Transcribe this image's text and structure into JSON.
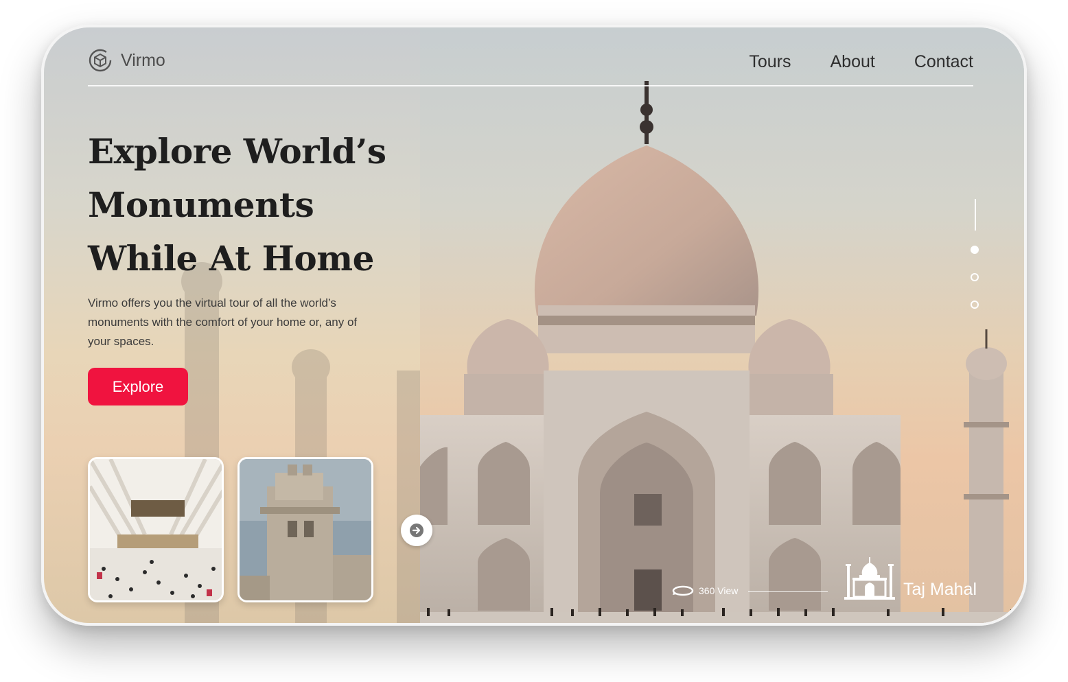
{
  "brand": {
    "name": "Virmo"
  },
  "nav": {
    "items": [
      "Tours",
      "About",
      "Contact"
    ]
  },
  "hero": {
    "headline": [
      "Explore World’s",
      "Monuments",
      "While At Home"
    ],
    "description": "Virmo offers you the virtual tour of all the world’s monuments with the comfort of your home or, any of your spaces.",
    "cta_label": "Explore"
  },
  "slider": {
    "active_index": 0,
    "count": 3
  },
  "viewer": {
    "view_label": "360 View",
    "landmark_name": "Taj Mahal"
  },
  "colors": {
    "accent": "#f0133f",
    "text": "#1e1e1e"
  }
}
